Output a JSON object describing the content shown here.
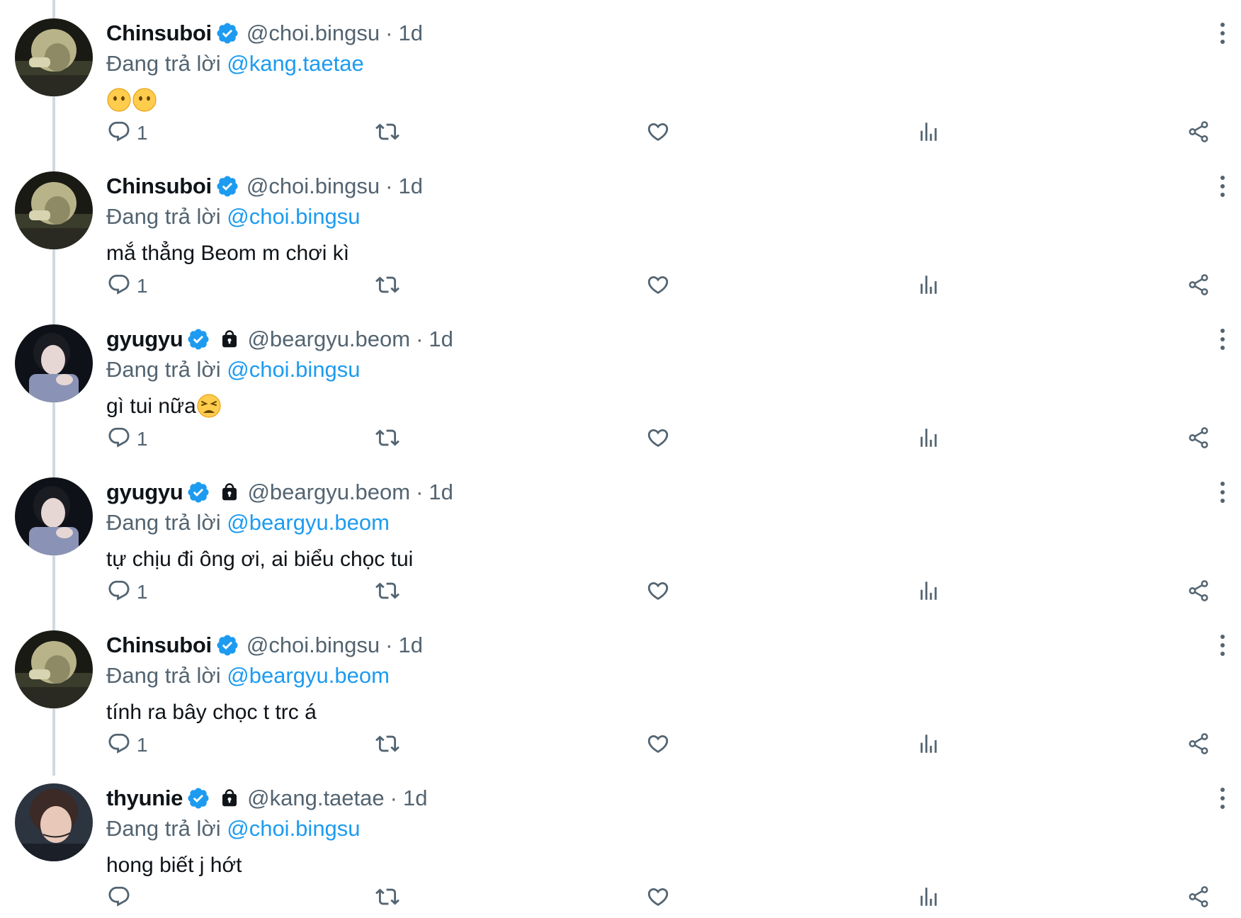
{
  "reply_prefix": "Đang trả lời ",
  "tweets": [
    {
      "display_name": "Chinsuboi",
      "handle": "@choi.bingsu",
      "separator": "·",
      "time": "1d",
      "reply_to": "@kang.taetae",
      "text": "",
      "emojis": [
        "face-without-mouth-emoji",
        "face-without-mouth-emoji"
      ],
      "reply_count": "1",
      "locked": false,
      "avatar": "chinsuboi-avatar"
    },
    {
      "display_name": "Chinsuboi",
      "handle": "@choi.bingsu",
      "separator": "·",
      "time": "1d",
      "reply_to": "@choi.bingsu",
      "text": "mắ thẳng Beom m chơi kì",
      "reply_count": "1",
      "locked": false,
      "avatar": "chinsuboi-avatar"
    },
    {
      "display_name": "gyugyu",
      "handle": "@beargyu.beom",
      "separator": "·",
      "time": "1d",
      "reply_to": "@choi.bingsu",
      "text": "gì tui nữa",
      "emojis": [
        "weary-face-emoji"
      ],
      "reply_count": "1",
      "locked": true,
      "avatar": "gyugyu-avatar"
    },
    {
      "display_name": "gyugyu",
      "handle": "@beargyu.beom",
      "separator": "·",
      "time": "1d",
      "reply_to": "@beargyu.beom",
      "text": "tự chịu đi ông ơi, ai biểu chọc tui",
      "reply_count": "1",
      "locked": true,
      "avatar": "gyugyu-avatar"
    },
    {
      "display_name": "Chinsuboi",
      "handle": "@choi.bingsu",
      "separator": "·",
      "time": "1d",
      "reply_to": "@beargyu.beom",
      "text": "tính ra bây chọc t trc á",
      "reply_count": "1",
      "locked": false,
      "avatar": "chinsuboi-avatar"
    },
    {
      "display_name": "thyunie",
      "handle": "@kang.taetae",
      "separator": "·",
      "time": "1d",
      "reply_to": "@choi.bingsu",
      "text": "hong biết j hớt",
      "reply_count": "",
      "locked": true,
      "avatar": "thyunie-avatar"
    }
  ],
  "colors": {
    "text": "#0f1419",
    "secondary": "#536471",
    "accent": "#1d9bf0",
    "thread_line": "#cfd9de"
  }
}
